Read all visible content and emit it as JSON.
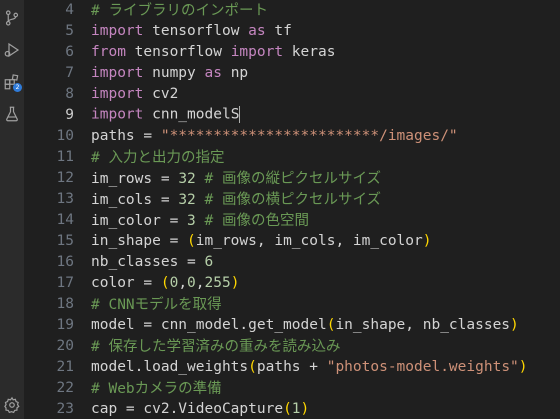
{
  "activity_bar": {
    "items": [
      {
        "icon": "source-control-icon"
      },
      {
        "icon": "run-debug-icon"
      },
      {
        "icon": "extensions-icon",
        "badge": "2"
      },
      {
        "icon": "testing-icon"
      },
      {
        "icon": "settings-gear-icon"
      }
    ]
  },
  "editor": {
    "current_line": 9,
    "lines": [
      {
        "n": "4",
        "tokens": [
          {
            "t": "cm",
            "v": "# ライブラリのインポート"
          }
        ]
      },
      {
        "n": "5",
        "tokens": [
          {
            "t": "kw",
            "v": "import"
          },
          {
            "t": "plain",
            "v": " tensorflow "
          },
          {
            "t": "kw",
            "v": "as"
          },
          {
            "t": "plain",
            "v": " tf"
          }
        ]
      },
      {
        "n": "6",
        "tokens": [
          {
            "t": "kw",
            "v": "from"
          },
          {
            "t": "plain",
            "v": " tensorflow "
          },
          {
            "t": "kw",
            "v": "import"
          },
          {
            "t": "plain",
            "v": " keras"
          }
        ]
      },
      {
        "n": "7",
        "tokens": [
          {
            "t": "kw",
            "v": "import"
          },
          {
            "t": "plain",
            "v": " numpy "
          },
          {
            "t": "kw",
            "v": "as"
          },
          {
            "t": "plain",
            "v": " np"
          }
        ]
      },
      {
        "n": "8",
        "tokens": [
          {
            "t": "kw",
            "v": "import"
          },
          {
            "t": "plain",
            "v": " cv2"
          }
        ]
      },
      {
        "n": "9",
        "tokens": [
          {
            "t": "kw",
            "v": "import"
          },
          {
            "t": "plain",
            "v": " cnn_modelS"
          }
        ]
      },
      {
        "n": "10",
        "tokens": [
          {
            "t": "plain",
            "v": "paths = "
          },
          {
            "t": "str",
            "v": "\"************************/images/\""
          }
        ]
      },
      {
        "n": "11",
        "tokens": [
          {
            "t": "cm",
            "v": "# 入力と出力の指定"
          }
        ]
      },
      {
        "n": "12",
        "tokens": [
          {
            "t": "plain",
            "v": "im_rows = "
          },
          {
            "t": "num",
            "v": "32"
          },
          {
            "t": "plain",
            "v": " "
          },
          {
            "t": "cm",
            "v": "# 画像の縦ピクセルサイズ"
          }
        ]
      },
      {
        "n": "13",
        "tokens": [
          {
            "t": "plain",
            "v": "im_cols = "
          },
          {
            "t": "num",
            "v": "32"
          },
          {
            "t": "plain",
            "v": " "
          },
          {
            "t": "cm",
            "v": "# 画像の横ピクセルサイズ"
          }
        ]
      },
      {
        "n": "14",
        "tokens": [
          {
            "t": "plain",
            "v": "im_color = "
          },
          {
            "t": "num",
            "v": "3"
          },
          {
            "t": "plain",
            "v": " "
          },
          {
            "t": "cm",
            "v": "# 画像の色空間"
          }
        ]
      },
      {
        "n": "15",
        "tokens": [
          {
            "t": "plain",
            "v": "in_shape = "
          },
          {
            "t": "br1",
            "v": "("
          },
          {
            "t": "plain",
            "v": "im_rows, im_cols, im_color"
          },
          {
            "t": "br1",
            "v": ")"
          }
        ]
      },
      {
        "n": "16",
        "tokens": [
          {
            "t": "plain",
            "v": "nb_classes = "
          },
          {
            "t": "num",
            "v": "6"
          }
        ]
      },
      {
        "n": "17",
        "tokens": [
          {
            "t": "plain",
            "v": "color = "
          },
          {
            "t": "br1",
            "v": "("
          },
          {
            "t": "num",
            "v": "0"
          },
          {
            "t": "plain",
            "v": ","
          },
          {
            "t": "num",
            "v": "0"
          },
          {
            "t": "plain",
            "v": ","
          },
          {
            "t": "num",
            "v": "255"
          },
          {
            "t": "br1",
            "v": ")"
          }
        ]
      },
      {
        "n": "18",
        "tokens": [
          {
            "t": "cm",
            "v": "# CNNモデルを取得"
          }
        ]
      },
      {
        "n": "19",
        "tokens": [
          {
            "t": "plain",
            "v": "model = cnn_model.get_model"
          },
          {
            "t": "br1",
            "v": "("
          },
          {
            "t": "plain",
            "v": "in_shape, nb_classes"
          },
          {
            "t": "br1",
            "v": ")"
          }
        ]
      },
      {
        "n": "20",
        "tokens": [
          {
            "t": "cm",
            "v": "# 保存した学習済みの重みを読み込み"
          }
        ]
      },
      {
        "n": "21",
        "tokens": [
          {
            "t": "plain",
            "v": "model.load_weights"
          },
          {
            "t": "br1",
            "v": "("
          },
          {
            "t": "plain",
            "v": "paths + "
          },
          {
            "t": "str",
            "v": "\"photos-model.weights\""
          },
          {
            "t": "br1",
            "v": ")"
          }
        ]
      },
      {
        "n": "22",
        "tokens": [
          {
            "t": "cm",
            "v": "# Webカメラの準備"
          }
        ]
      },
      {
        "n": "23",
        "tokens": [
          {
            "t": "plain",
            "v": "cap = cv2.VideoCapture"
          },
          {
            "t": "br1",
            "v": "("
          },
          {
            "t": "num",
            "v": "1"
          },
          {
            "t": "br1",
            "v": ")"
          }
        ]
      }
    ]
  }
}
